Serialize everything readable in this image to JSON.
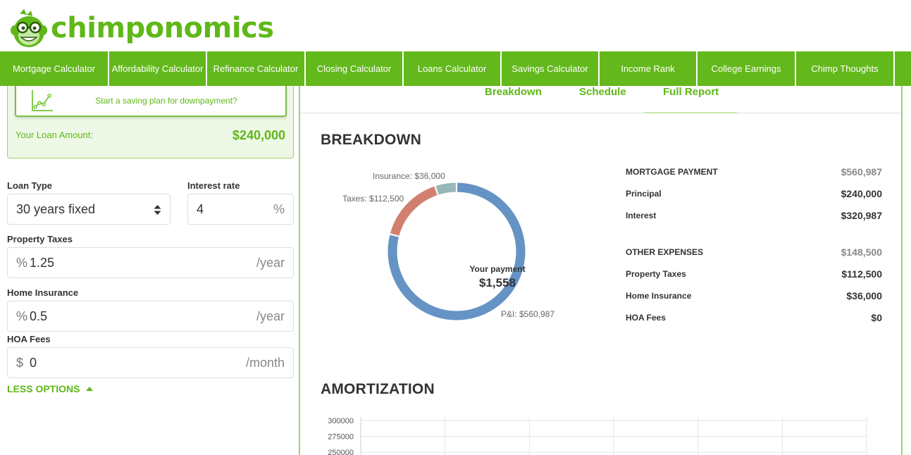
{
  "brand": {
    "logo_text": "chimponomics",
    "accent": "#5fb817",
    "nav_bg": "#63b81b"
  },
  "nav": {
    "items": [
      "Mortgage Calculator",
      "Affordability Calculator",
      "Refinance Calculator",
      "Closing Calculator",
      "Loans Calculator",
      "Savings Calculator",
      "Income Rank",
      "College Earnings",
      "Chimp Thoughts"
    ]
  },
  "left": {
    "saving_plan_label": "Start a saving plan for downpayment?",
    "loan_amount_label": "Your Loan Amount:",
    "loan_amount_value": "$240,000",
    "loan_type": {
      "label": "Loan Type",
      "value": "30 years fixed"
    },
    "interest_rate": {
      "label": "Interest rate",
      "value": "4",
      "suffix": "%"
    },
    "property_taxes": {
      "label": "Property Taxes",
      "prefix": "%",
      "value": "1.25",
      "suffix": "/year"
    },
    "home_insurance": {
      "label": "Home Insurance",
      "prefix": "%",
      "value": "0.5",
      "suffix": "/year"
    },
    "hoa_fees": {
      "label": "HOA Fees",
      "prefix": "$",
      "value": "0",
      "suffix": "/month"
    },
    "less_options": "LESS OPTIONS"
  },
  "tabs": {
    "breakdown": "Breakdown",
    "schedule": "Schedule",
    "full_report": "Full Report"
  },
  "breakdown": {
    "title": "BREAKDOWN",
    "center_title": "Your payment",
    "center_value": "$1,558",
    "labels": {
      "insurance": "Insurance: $36,000",
      "taxes": "Taxes: $112,500",
      "pi": "P&I: $560,987"
    },
    "segments": [
      {
        "name": "P&I",
        "value": 560987,
        "color": "#6593c4"
      },
      {
        "name": "Taxes",
        "value": 112500,
        "color": "#d1806f"
      },
      {
        "name": "Insurance",
        "value": 36000,
        "color": "#97b8b8"
      }
    ],
    "summary": {
      "mortgage_payment": {
        "label": "MORTGAGE PAYMENT",
        "value": "$560,987"
      },
      "principal": {
        "label": "Principal",
        "value": "$240,000"
      },
      "interest": {
        "label": "Interest",
        "value": "$320,987"
      },
      "other_expenses": {
        "label": "OTHER EXPENSES",
        "value": "$148,500"
      },
      "property_taxes": {
        "label": "Property Taxes",
        "value": "$112,500"
      },
      "home_insurance": {
        "label": "Home Insurance",
        "value": "$36,000"
      },
      "hoa_fees": {
        "label": "HOA Fees",
        "value": "$0"
      }
    }
  },
  "amortization": {
    "title": "AMORTIZATION",
    "y_ticks": [
      "300000",
      "275000",
      "250000"
    ]
  }
}
